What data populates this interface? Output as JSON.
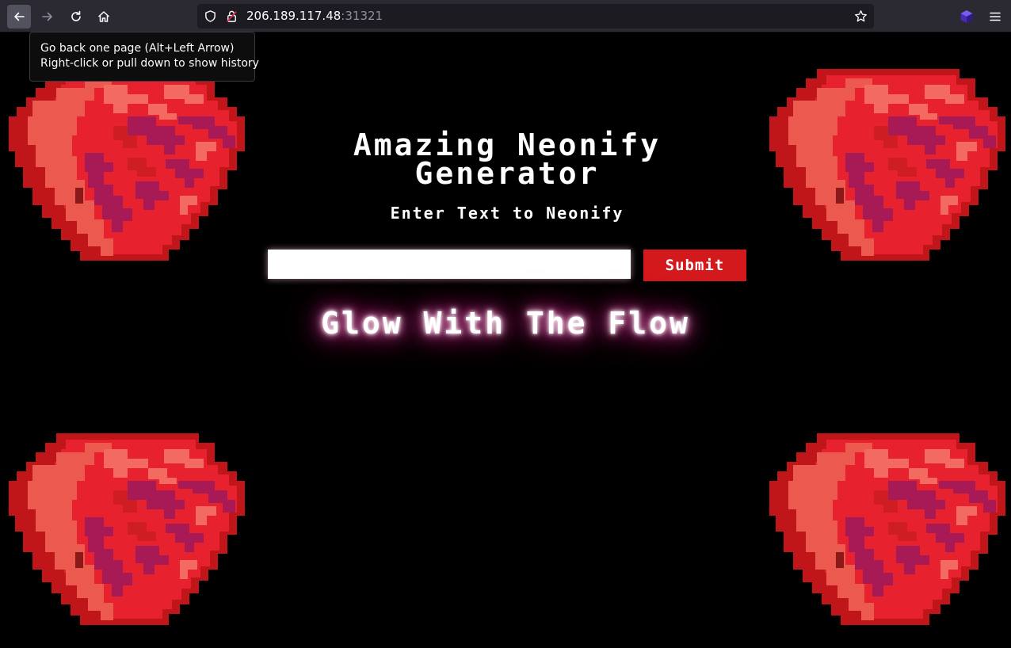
{
  "browser": {
    "url_host": "206.189.117.48",
    "url_port": ":31321",
    "icons": [
      "back-arrow-icon",
      "forward-arrow-icon",
      "reload-icon",
      "home-icon",
      "shield-icon",
      "insecure-lock-icon",
      "bookmark-star-icon",
      "extension-cube-icon",
      "hamburger-menu-icon"
    ],
    "tooltip": {
      "line1": "Go back one page (Alt+Left Arrow)",
      "line2": "Right-click or pull down to show history"
    }
  },
  "page": {
    "title": "Amazing Neonify Generator",
    "subtitle": "Enter Text to Neonify",
    "input_value": "",
    "submit_label": "Submit",
    "neon_output": "Glow With The Flow",
    "decorations": [
      "pixel-gem-top-left",
      "pixel-gem-top-right",
      "pixel-gem-bottom-left",
      "pixel-gem-bottom-right"
    ],
    "colors": {
      "background": "#000000",
      "submit_bg": "#d3191c",
      "gem_dark": "#c0161a",
      "gem_main": "#e8212e",
      "gem_light": "#ec5a4f",
      "gem_purple": "#a81a55",
      "neon_glow": "#ff4fb0"
    }
  }
}
